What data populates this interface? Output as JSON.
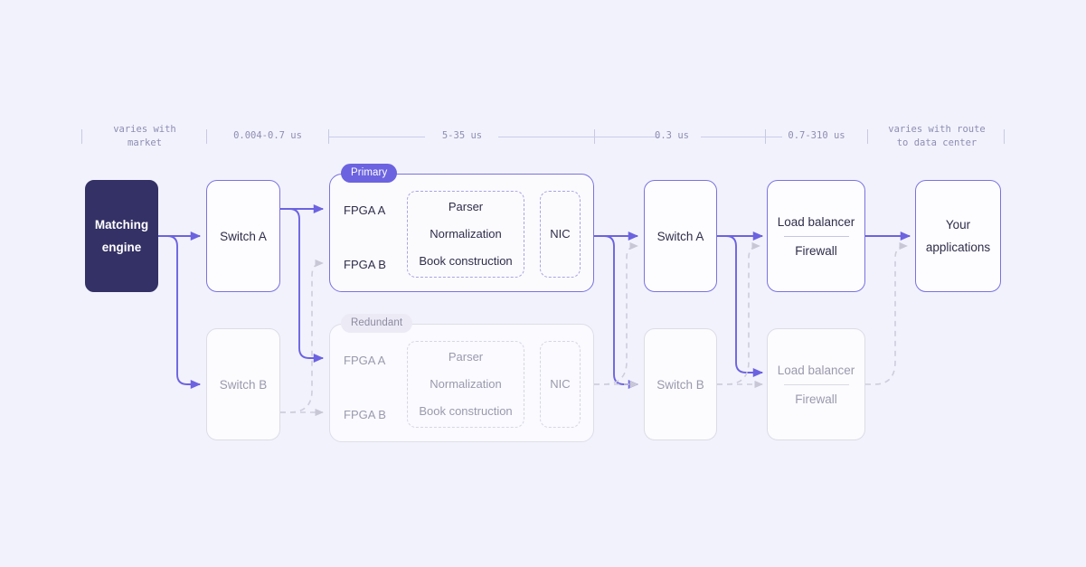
{
  "meta": {
    "title": "Market data path latency diagram",
    "background_color": "#f2f2fc",
    "accent_color": "#6c63e0",
    "dark_node_color": "#343166",
    "muted_color": "#9a99ad"
  },
  "timeline": {
    "segments": [
      {
        "id": "seg-market",
        "label": "varies with\nmarket"
      },
      {
        "id": "seg-switch",
        "label": "0.004-0.7 us"
      },
      {
        "id": "seg-fpga",
        "label": "5-35 us"
      },
      {
        "id": "seg-switch2",
        "label": "0.3 us"
      },
      {
        "id": "seg-lb",
        "label": "0.7-310 us"
      },
      {
        "id": "seg-datacenter",
        "label": "varies with route\nto data center"
      }
    ]
  },
  "nodes": {
    "matching_engine": {
      "lines": [
        "Matching",
        "engine"
      ]
    },
    "switch_a_left": {
      "lines": [
        "Switch A"
      ]
    },
    "switch_b_left": {
      "lines": [
        "Switch B"
      ]
    },
    "switch_a_right": {
      "lines": [
        "Switch A"
      ]
    },
    "switch_b_right": {
      "lines": [
        "Switch B"
      ]
    },
    "load_balancer_primary": {
      "top": "Load balancer",
      "bottom": "Firewall"
    },
    "load_balancer_redundant": {
      "top": "Load balancer",
      "bottom": "Firewall"
    },
    "your_applications": {
      "lines": [
        "Your",
        "applications"
      ]
    }
  },
  "groups": {
    "primary": {
      "badge": "Primary",
      "fpga_a": "FPGA A",
      "fpga_b": "FPGA B",
      "pipeline": [
        "Parser",
        "Normalization",
        "Book construction"
      ],
      "nic": "NIC"
    },
    "redundant": {
      "badge": "Redundant",
      "fpga_a": "FPGA A",
      "fpga_b": "FPGA B",
      "pipeline": [
        "Parser",
        "Normalization",
        "Book construction"
      ],
      "nic": "NIC"
    }
  }
}
